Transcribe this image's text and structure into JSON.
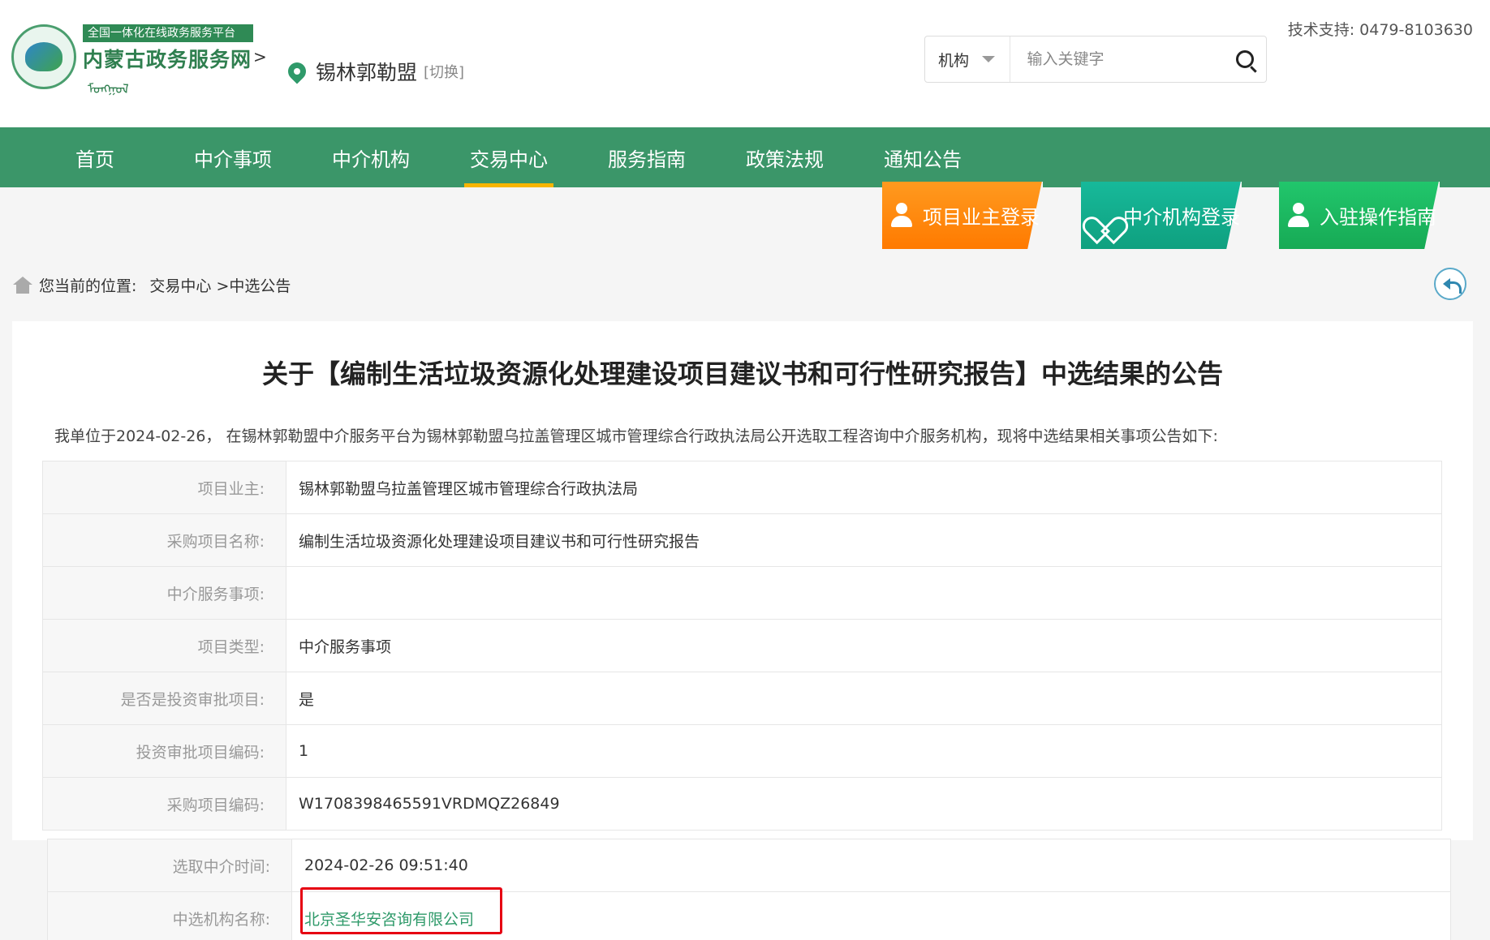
{
  "header": {
    "logo_top": "全国一体化在线政务服务平台",
    "logo_main": "内蒙古政务服务网",
    "logo_arrow": ">",
    "logo_script": "ᠮᠣᠩᠭᠣᠯ",
    "location_name": "锡林郭勒盟",
    "location_switch": "[切换]",
    "search_select": "机构",
    "search_placeholder": "输入关键字",
    "support": "技术支持: 0479-8103630"
  },
  "nav": {
    "items": [
      "首页",
      "中介事项",
      "中介机构",
      "交易中心",
      "服务指南",
      "政策法规",
      "通知公告"
    ],
    "active": "交易中心"
  },
  "quick_buttons": [
    "项目业主登录",
    "中介机构登录",
    "入驻操作指南"
  ],
  "breadcrumb": {
    "prefix": "您当前的位置:",
    "path": "交易中心 >中选公告"
  },
  "announcement": {
    "title": "关于【编制生活垃圾资源化处理建设项目建议书和可行性研究报告】中选结果的公告",
    "intro": "我单位于2024-02-26， 在锡林郭勒盟中介服务平台为锡林郭勒盟乌拉盖管理区城市管理综合行政执法局公开选取工程咨询中介服务机构，现将中选结果相关事项公告如下:",
    "rows": [
      {
        "label": "项目业主:",
        "value": "锡林郭勒盟乌拉盖管理区城市管理综合行政执法局"
      },
      {
        "label": "采购项目名称:",
        "value": "编制生活垃圾资源化处理建设项目建议书和可行性研究报告"
      },
      {
        "label": "中介服务事项:",
        "value": ""
      },
      {
        "label": "项目类型:",
        "value": "中介服务事项"
      },
      {
        "label": "是否是投资审批项目:",
        "value": "是"
      },
      {
        "label": "投资审批项目编码:",
        "value": "1"
      },
      {
        "label": "采购项目编码:",
        "value": "W1708398465591VRDMQZ26849"
      }
    ],
    "rows2": [
      {
        "label": "选取中介时间:",
        "value": "2024-02-26 09:51:40"
      },
      {
        "label": "中选机构名称:",
        "value": "北京圣华安咨询有限公司"
      }
    ]
  },
  "colors": {
    "nav_green": "#3b9669",
    "active_underline": "#f7b500",
    "highlight_box": "#e60012",
    "agency_link": "#2f9a6a"
  }
}
